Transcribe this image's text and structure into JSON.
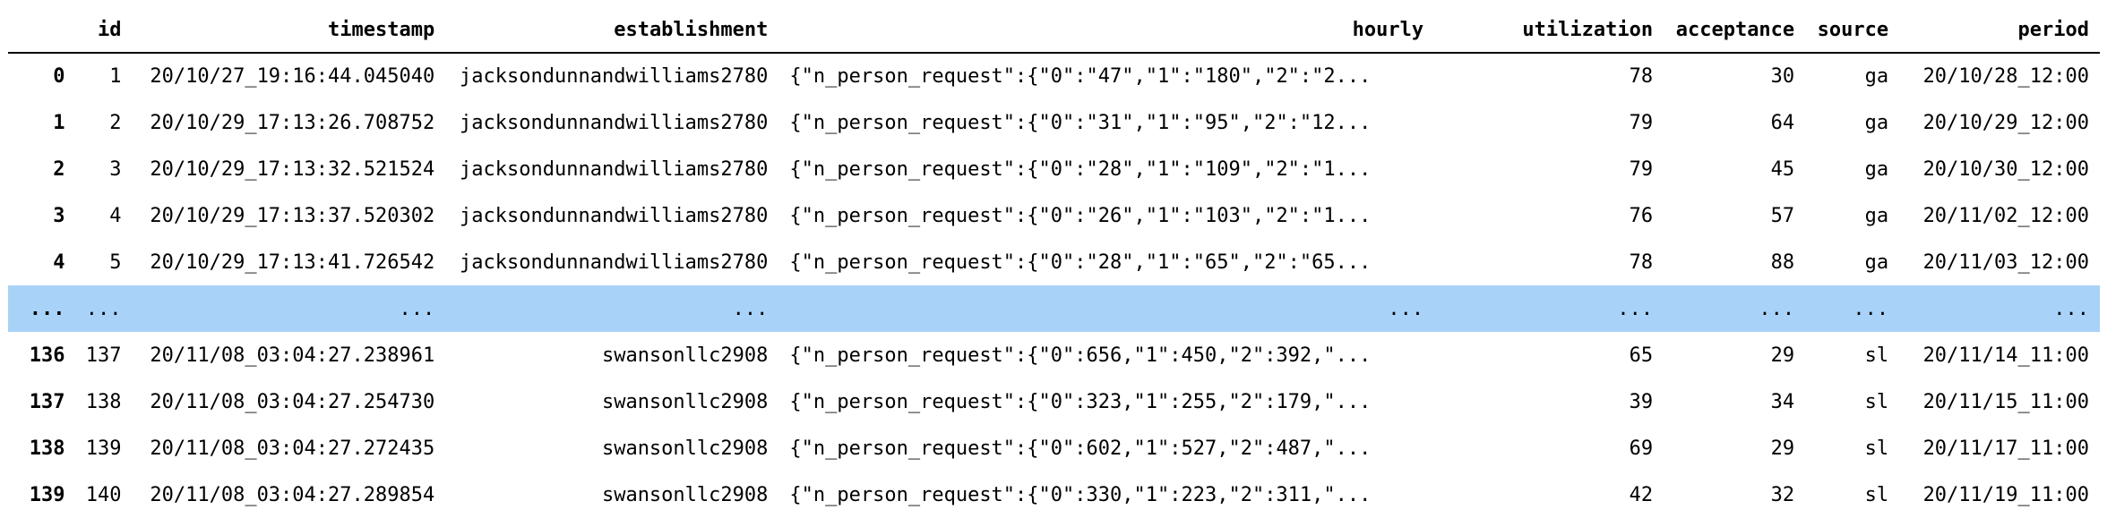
{
  "table": {
    "columns": {
      "index": "",
      "id": "id",
      "timestamp": "timestamp",
      "establishment": "establishment",
      "hourly": "hourly",
      "utilization": "utilization",
      "acceptance": "acceptance",
      "source": "source",
      "period": "period"
    },
    "rows": [
      {
        "index": "0",
        "id": "1",
        "timestamp": "20/10/27_19:16:44.045040",
        "establishment": "jacksondunnandwilliams2780",
        "hourly": "{\"n_person_request\":{\"0\":\"47\",\"1\":\"180\",\"2\":\"2...",
        "utilization": "78",
        "acceptance": "30",
        "source": "ga",
        "period": "20/10/28_12:00"
      },
      {
        "index": "1",
        "id": "2",
        "timestamp": "20/10/29_17:13:26.708752",
        "establishment": "jacksondunnandwilliams2780",
        "hourly": "{\"n_person_request\":{\"0\":\"31\",\"1\":\"95\",\"2\":\"12...",
        "utilization": "79",
        "acceptance": "64",
        "source": "ga",
        "period": "20/10/29_12:00"
      },
      {
        "index": "2",
        "id": "3",
        "timestamp": "20/10/29_17:13:32.521524",
        "establishment": "jacksondunnandwilliams2780",
        "hourly": "{\"n_person_request\":{\"0\":\"28\",\"1\":\"109\",\"2\":\"1...",
        "utilization": "79",
        "acceptance": "45",
        "source": "ga",
        "period": "20/10/30_12:00"
      },
      {
        "index": "3",
        "id": "4",
        "timestamp": "20/10/29_17:13:37.520302",
        "establishment": "jacksondunnandwilliams2780",
        "hourly": "{\"n_person_request\":{\"0\":\"26\",\"1\":\"103\",\"2\":\"1...",
        "utilization": "76",
        "acceptance": "57",
        "source": "ga",
        "period": "20/11/02_12:00"
      },
      {
        "index": "4",
        "id": "5",
        "timestamp": "20/10/29_17:13:41.726542",
        "establishment": "jacksondunnandwilliams2780",
        "hourly": "{\"n_person_request\":{\"0\":\"28\",\"1\":\"65\",\"2\":\"65...",
        "utilization": "78",
        "acceptance": "88",
        "source": "ga",
        "period": "20/11/03_12:00"
      },
      {
        "ellipsis": true,
        "index": "...",
        "id": "...",
        "timestamp": "...",
        "establishment": "...",
        "hourly": "...",
        "utilization": "...",
        "acceptance": "...",
        "source": "...",
        "period": "..."
      },
      {
        "index": "136",
        "id": "137",
        "timestamp": "20/11/08_03:04:27.238961",
        "establishment": "swansonllc2908",
        "hourly": "{\"n_person_request\":{\"0\":656,\"1\":450,\"2\":392,\"...",
        "utilization": "65",
        "acceptance": "29",
        "source": "sl",
        "period": "20/11/14_11:00"
      },
      {
        "index": "137",
        "id": "138",
        "timestamp": "20/11/08_03:04:27.254730",
        "establishment": "swansonllc2908",
        "hourly": "{\"n_person_request\":{\"0\":323,\"1\":255,\"2\":179,\"...",
        "utilization": "39",
        "acceptance": "34",
        "source": "sl",
        "period": "20/11/15_11:00"
      },
      {
        "index": "138",
        "id": "139",
        "timestamp": "20/11/08_03:04:27.272435",
        "establishment": "swansonllc2908",
        "hourly": "{\"n_person_request\":{\"0\":602,\"1\":527,\"2\":487,\"...",
        "utilization": "69",
        "acceptance": "29",
        "source": "sl",
        "period": "20/11/17_11:00"
      },
      {
        "index": "139",
        "id": "140",
        "timestamp": "20/11/08_03:04:27.289854",
        "establishment": "swansonllc2908",
        "hourly": "{\"n_person_request\":{\"0\":330,\"1\":223,\"2\":311,\"...",
        "utilization": "42",
        "acceptance": "32",
        "source": "sl",
        "period": "20/11/19_11:00"
      }
    ]
  },
  "colors": {
    "ellipsis_row_bg": "#a9d2f9",
    "header_rule": "#000000"
  }
}
